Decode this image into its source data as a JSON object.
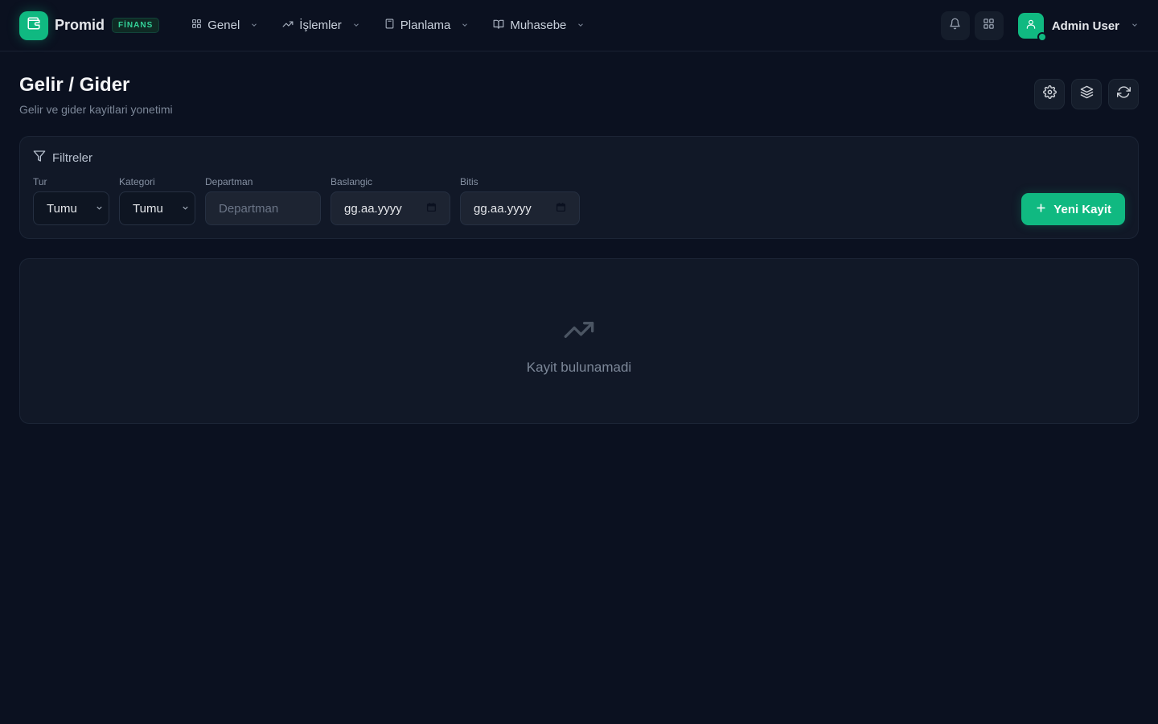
{
  "brand": {
    "name": "Promid",
    "badge": "FİNANS",
    "icon": "wallet-icon"
  },
  "nav": [
    {
      "label": "Genel",
      "icon": "grid-icon"
    },
    {
      "label": "İşlemler",
      "icon": "trending-up-icon"
    },
    {
      "label": "Planlama",
      "icon": "calculator-icon"
    },
    {
      "label": "Muhasebe",
      "icon": "book-open-icon"
    }
  ],
  "user": {
    "name": "Admin User",
    "status": "online"
  },
  "page": {
    "title": "Gelir / Gider",
    "subtitle": "Gelir ve gider kayitlari yonetimi"
  },
  "filters": {
    "title": "Filtreler",
    "tur": {
      "label": "Tur",
      "value": "Tumu"
    },
    "kategori": {
      "label": "Kategori",
      "value": "Tumu"
    },
    "departman": {
      "label": "Departman",
      "placeholder": "Departman"
    },
    "baslangic": {
      "label": "Baslangic",
      "value": "gg.aa.yyyy"
    },
    "bitis": {
      "label": "Bitis",
      "value": "gg.aa.yyyy"
    },
    "new_button": "Yeni Kayit"
  },
  "empty_state": {
    "message": "Kayit bulunamadi"
  },
  "colors": {
    "accent": "#10b981",
    "background": "#0b1120",
    "card": "#111827"
  }
}
